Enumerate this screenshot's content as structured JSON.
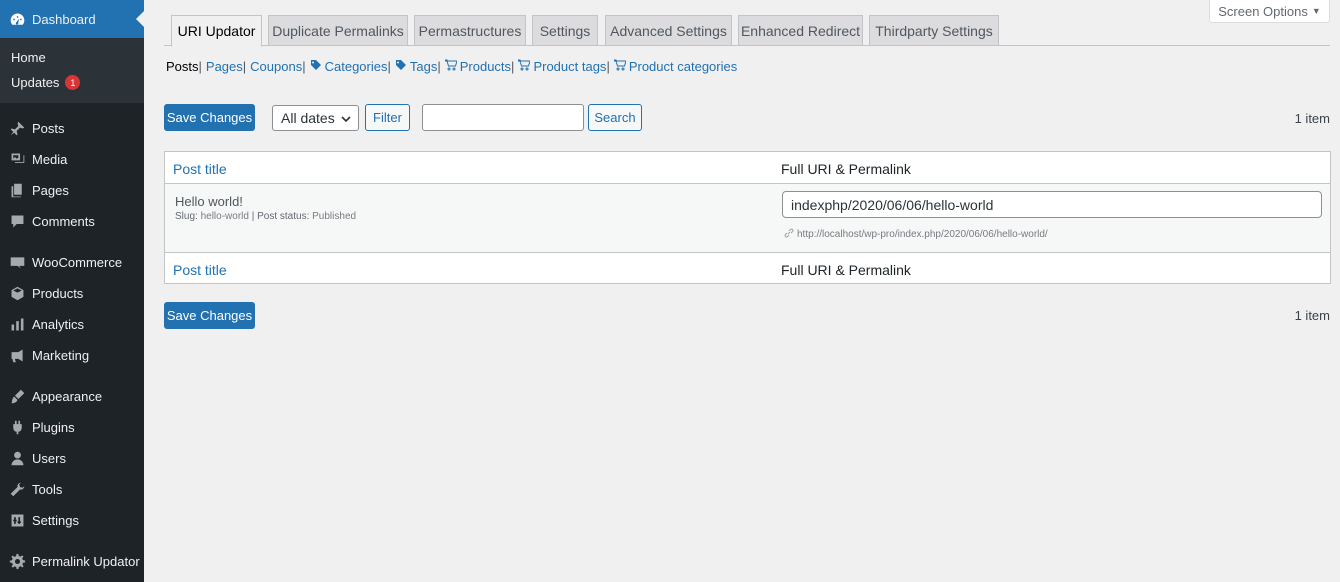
{
  "sidebar": {
    "dashboard": "Dashboard",
    "submenu": {
      "home": "Home",
      "updates": "Updates",
      "updates_count": "1"
    },
    "items": [
      {
        "label": "Posts",
        "icon": "pin-icon"
      },
      {
        "label": "Media",
        "icon": "media-icon"
      },
      {
        "label": "Pages",
        "icon": "pages-icon"
      },
      {
        "label": "Comments",
        "icon": "comments-icon"
      },
      {
        "label": "WooCommerce",
        "icon": "woocommerce-icon"
      },
      {
        "label": "Products",
        "icon": "products-icon"
      },
      {
        "label": "Analytics",
        "icon": "analytics-icon"
      },
      {
        "label": "Marketing",
        "icon": "megaphone-icon"
      },
      {
        "label": "Appearance",
        "icon": "brush-icon"
      },
      {
        "label": "Plugins",
        "icon": "plugin-icon"
      },
      {
        "label": "Users",
        "icon": "users-icon"
      },
      {
        "label": "Tools",
        "icon": "wrench-icon"
      },
      {
        "label": "Settings",
        "icon": "settings-icon"
      },
      {
        "label": "Permalink Updator",
        "icon": "gear-icon"
      }
    ]
  },
  "screen_options": {
    "label": "Screen Options",
    "arrow": "▼"
  },
  "tabs": [
    {
      "label": "URI Updator",
      "active": true
    },
    {
      "label": "Duplicate Permalinks"
    },
    {
      "label": "Permastructures"
    },
    {
      "label": "Settings"
    },
    {
      "label": "Advanced Settings"
    },
    {
      "label": "Enhanced Redirect"
    },
    {
      "label": "Thirdparty Settings"
    }
  ],
  "subnav": {
    "posts": "Posts",
    "pages": "Pages",
    "coupons": "Coupons",
    "categories": "Categories",
    "tags": "Tags",
    "products": "Products",
    "product_tags": "Product tags",
    "product_categories": "Product categories",
    "separator": "|"
  },
  "toolbar": {
    "save_label": "Save Changes",
    "date_filter": "All dates",
    "filter_label": "Filter",
    "search_value": "",
    "search_label": "Search",
    "item_count": "1 item"
  },
  "table": {
    "col_title": "Post title",
    "col_uri": "Full URI & Permalink",
    "row": {
      "title": "Hello world!",
      "slug_label": "Slug:",
      "slug": "hello-world",
      "status_label": "Post status:",
      "status": "Published",
      "uri": "indexphp/2020/06/06/hello-world",
      "permalink": "http://localhost/wp-pro/index.php/2020/06/06/hello-world/"
    }
  },
  "colors": {
    "accent": "#2271b1",
    "sidebar_bg": "#1d2327",
    "badge": "#d63638"
  }
}
